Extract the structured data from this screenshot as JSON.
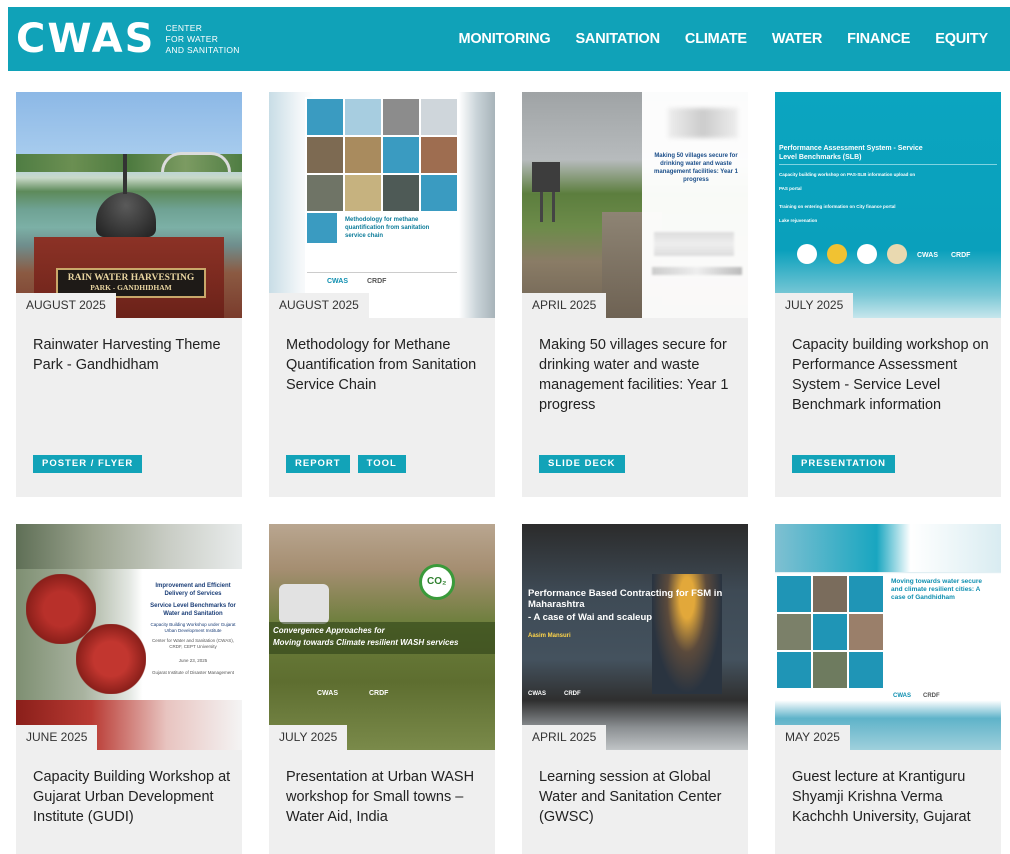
{
  "header": {
    "logo_mark": "CWAS",
    "logo_sub": [
      "CENTER",
      "FOR WATER",
      "AND SANITATION"
    ],
    "nav": [
      "MONITORING",
      "SANITATION",
      "CLIMATE",
      "WATER",
      "FINANCE",
      "EQUITY"
    ]
  },
  "cards": [
    {
      "date": "AUGUST 2025",
      "title": "Rainwater Harvesting Theme Park - Gandhidham",
      "tags": [
        "POSTER / FLYER"
      ],
      "image_text": [
        "RAIN WATER HARVESTING",
        "PARK - GANDHIDHAM"
      ]
    },
    {
      "date": "AUGUST 2025",
      "title": "Methodology for Methane Quantification from Sanitation Service Chain",
      "tags": [
        "REPORT",
        "TOOL"
      ],
      "image_text": [
        "Methodology for methane quantification from sanitation service chain",
        "CWAS",
        "CRDF"
      ]
    },
    {
      "date": "APRIL 2025",
      "title": "Making 50 villages secure for drinking water and waste management facilities: Year 1 progress",
      "tags": [
        "SLIDE DECK"
      ],
      "image_text": [
        "Making 50 villages secure for drinking water and waste management facilities: Year 1 progress"
      ]
    },
    {
      "date": "JULY 2025",
      "title": "Capacity building workshop on Performance Assessment System - Service Level Benchmark information",
      "tags": [
        "PRESENTATION"
      ],
      "image_text": [
        "Performance Assessment System - Service Level Benchmarks (SLB)",
        "Capacity building workshop on PAS-SLB information upload on",
        "PAS portal",
        "Training on entering information on City finance portal",
        "Lake rejuvenation",
        "CWAS",
        "CRDF"
      ]
    },
    {
      "date": "JUNE 2025",
      "title": "Capacity Building Workshop at Gujarat Urban Development Institute (GUDI)",
      "tags": [],
      "image_text": [
        "Improvement and Efficient Delivery of Services",
        "Service Level Benchmarks for Water and Sanitation",
        "Capacity Building Workshop under Gujarat Urban Development Institute",
        "Center for Water and Sanitation (CWAS), CRDF, CEPT University",
        "June 23, 2025",
        "Gujarat Institute of Disaster Management"
      ]
    },
    {
      "date": "JULY 2025",
      "title": "Presentation at Urban WASH workshop for Small towns – Water Aid, India",
      "tags": [],
      "image_text": [
        "Convergence Approaches for",
        "Moving towards Climate resilient WASH services",
        "CWAS",
        "CRDF"
      ]
    },
    {
      "date": "APRIL 2025",
      "title": "Learning session at Global Water and Sanitation Center (GWSC)",
      "tags": [],
      "image_text": [
        "Performance Based Contracting for FSM in Maharashtra",
        "- A case of Wai and scaleup",
        "Aasim Mansuri",
        "CWAS",
        "CRDF"
      ]
    },
    {
      "date": "MAY 2025",
      "title": "Guest lecture at Krantiguru Shyamji Krishna Verma Kachchh University, Gujarat",
      "tags": [],
      "image_text": [
        "Moving towards water secure and climate resilient cities: A case of Gandhidham",
        "CWAS",
        "CRDF"
      ]
    }
  ]
}
